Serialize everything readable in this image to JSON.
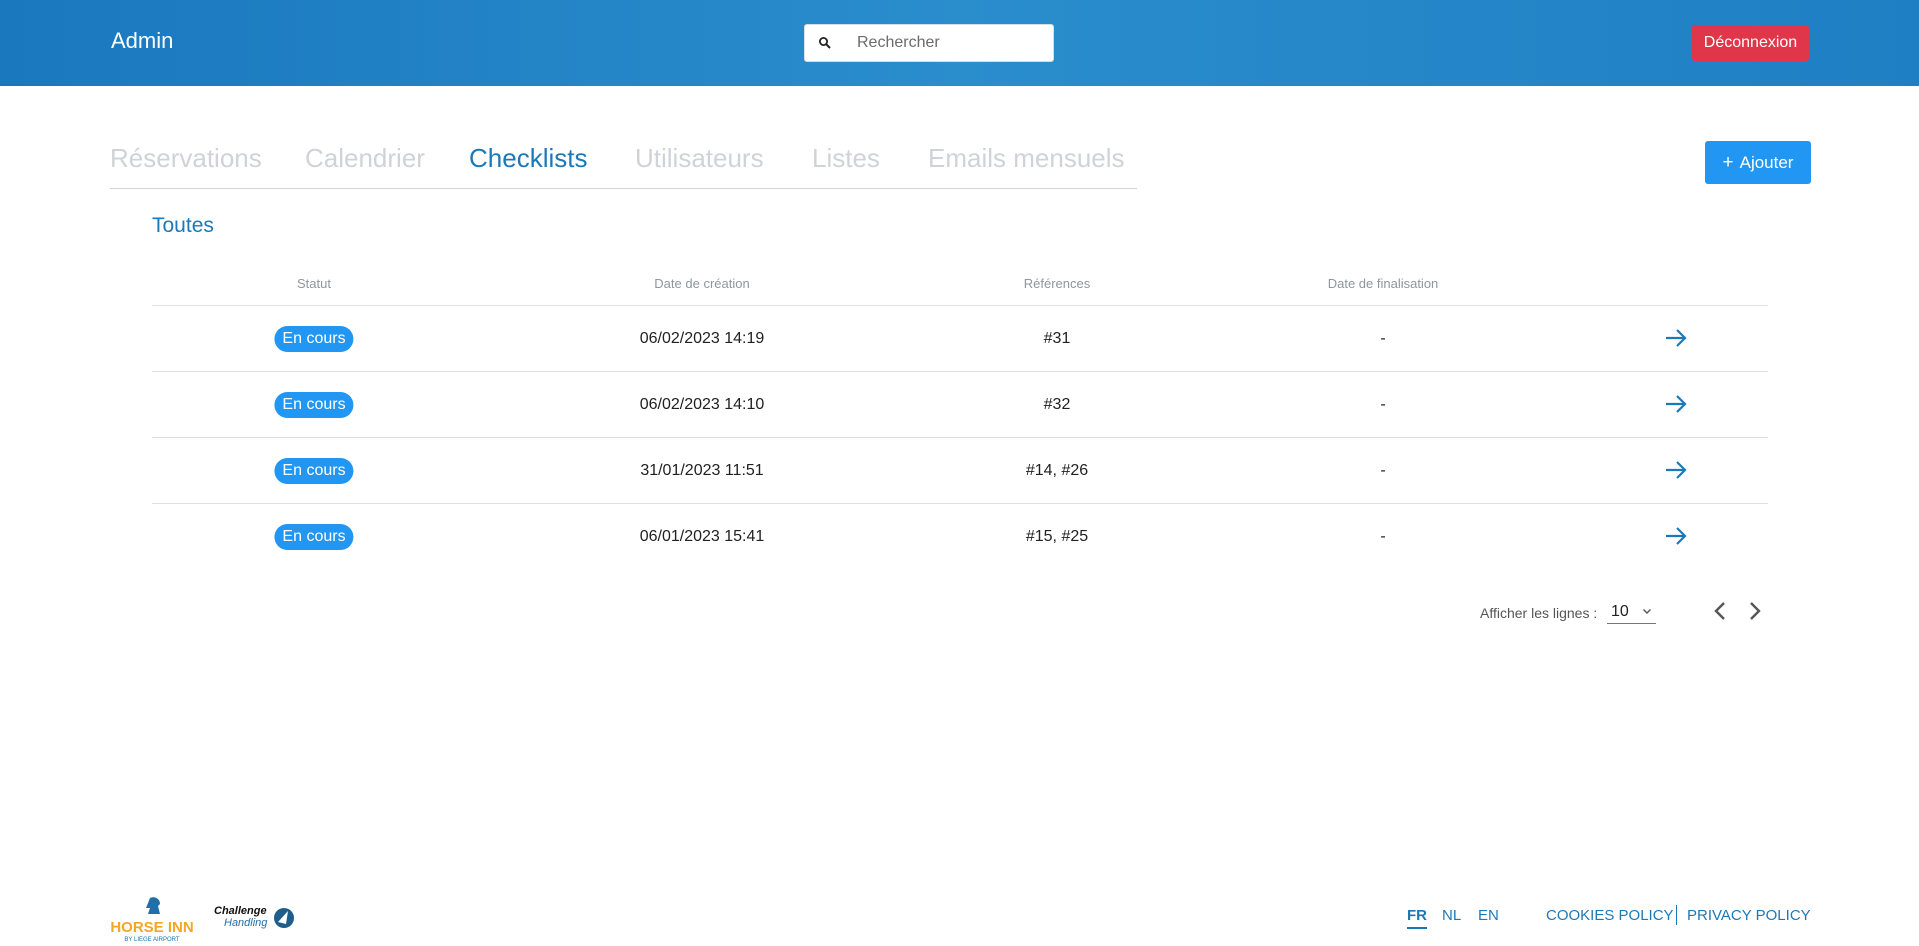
{
  "header": {
    "brand": "Admin",
    "search_placeholder": "Rechercher",
    "logout_label": "Déconnexion"
  },
  "tabs": [
    {
      "label": "Réservations",
      "active": false
    },
    {
      "label": "Calendrier",
      "active": false
    },
    {
      "label": "Checklists",
      "active": true
    },
    {
      "label": "Utilisateurs",
      "active": false
    },
    {
      "label": "Listes",
      "active": false
    },
    {
      "label": "Emails mensuels",
      "active": false
    }
  ],
  "add_button_label": "Ajouter",
  "section_title": "Toutes",
  "table": {
    "columns": [
      "Statut",
      "Date de création",
      "Références",
      "Date de finalisation"
    ],
    "rows": [
      {
        "status": "En cours",
        "created": "06/02/2023 14:19",
        "refs": "#31",
        "finalized": "-"
      },
      {
        "status": "En cours",
        "created": "06/02/2023 14:10",
        "refs": "#32",
        "finalized": "-"
      },
      {
        "status": "En cours",
        "created": "31/01/2023 11:51",
        "refs": "#14, #26",
        "finalized": "-"
      },
      {
        "status": "En cours",
        "created": "06/01/2023 15:41",
        "refs": "#15, #25",
        "finalized": "-"
      }
    ]
  },
  "pagination": {
    "rows_label": "Afficher les lignes :",
    "rows_value": "10"
  },
  "footer": {
    "languages": [
      {
        "code": "FR",
        "active": true
      },
      {
        "code": "NL",
        "active": false
      },
      {
        "code": "EN",
        "active": false
      }
    ],
    "cookies_label": "COOKIES POLICY",
    "privacy_label": "PRIVACY POLICY",
    "logo_horse_inn": "HORSE INN",
    "logo_horse_inn_sub": "BY LIEGE AIRPORT",
    "logo_challenge": "Challenge",
    "logo_challenge_sub": "Handling"
  },
  "colors": {
    "primary": "#2196f3",
    "accent_text": "#1c79b8",
    "danger": "#e0364a",
    "tab_inactive": "#cfd3d8",
    "logo_orange": "#f5a623"
  }
}
